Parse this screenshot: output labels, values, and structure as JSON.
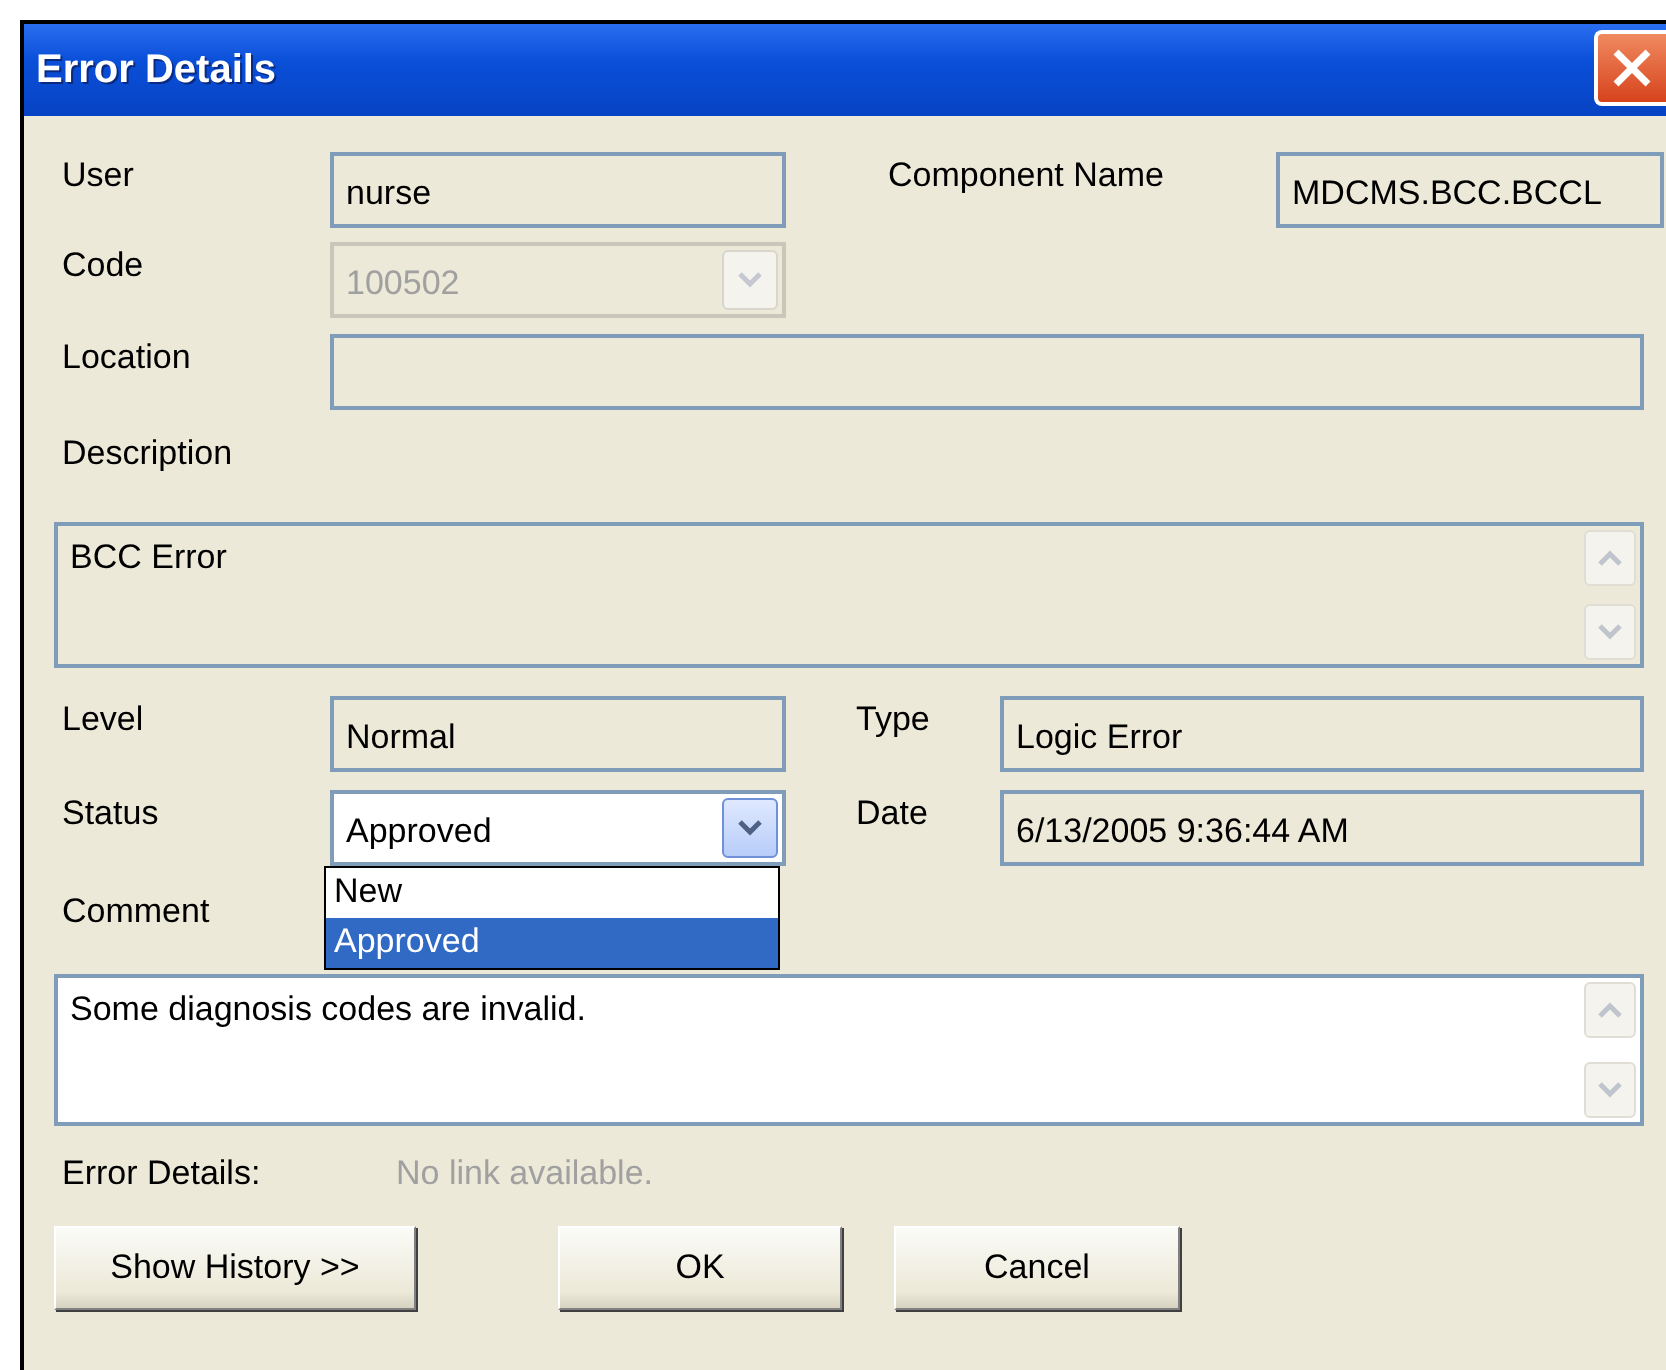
{
  "window": {
    "title": "Error Details"
  },
  "user": {
    "label": "User",
    "value": "nurse"
  },
  "component_name": {
    "label": "Component Name",
    "value": "MDCMS.BCC.BCCL"
  },
  "code": {
    "label": "Code",
    "value": "100502",
    "disabled": true
  },
  "location": {
    "label": "Location"
  },
  "description": {
    "label": "Description",
    "value": "BCC Error"
  },
  "level": {
    "label": "Level",
    "value": "Normal"
  },
  "type": {
    "label": "Type",
    "value": "Logic Error"
  },
  "status": {
    "label": "Status",
    "value": "Approved",
    "expanded": true,
    "options": [
      {
        "label": "New",
        "selected": false
      },
      {
        "label": "Approved",
        "selected": true
      }
    ]
  },
  "date": {
    "label": "Date",
    "value": "6/13/2005 9:36:44 AM"
  },
  "comment": {
    "label": "Comment",
    "value": "Some diagnosis codes are invalid."
  },
  "error_details": {
    "label": "Error Details:",
    "value": "No link available."
  },
  "buttons": [
    {
      "label": "Show History >>"
    },
    {
      "label": "OK"
    },
    {
      "label": "Cancel"
    }
  ]
}
